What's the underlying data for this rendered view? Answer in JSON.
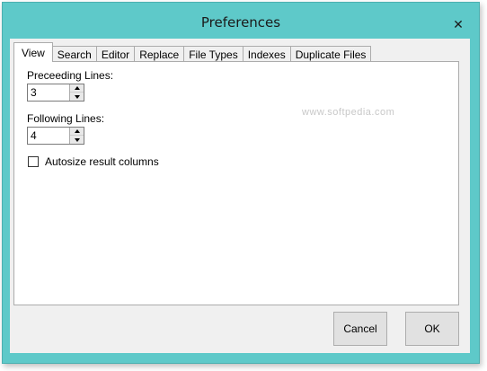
{
  "window": {
    "title": "Preferences",
    "close_label": "✕"
  },
  "tabs": [
    {
      "label": "View"
    },
    {
      "label": "Search"
    },
    {
      "label": "Editor"
    },
    {
      "label": "Replace"
    },
    {
      "label": "File Types"
    },
    {
      "label": "Indexes"
    },
    {
      "label": "Duplicate Files"
    }
  ],
  "view": {
    "preceding_label": "Preceeding Lines:",
    "preceding_value": "3",
    "following_label": "Following Lines:",
    "following_value": "4",
    "autosize_label": "Autosize result columns",
    "autosize_checked": false
  },
  "buttons": {
    "cancel": "Cancel",
    "ok": "OK"
  },
  "watermark": "www.softpedia.com",
  "colors": {
    "titlebar": "#5ec9c9",
    "client": "#f0f0f0",
    "panel": "#ffffff"
  }
}
